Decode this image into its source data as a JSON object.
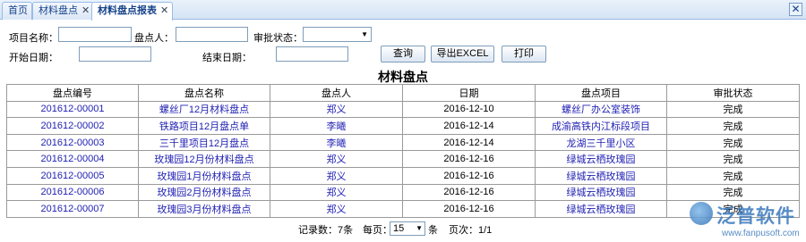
{
  "tabs": [
    {
      "label": "首页",
      "closable": false
    },
    {
      "label": "材料盘点",
      "closable": true
    },
    {
      "label": "材料盘点报表",
      "closable": true,
      "active": true
    }
  ],
  "window_close_label": "✕",
  "filters": {
    "project_name_label": "项目名称：",
    "project_name_value": "",
    "inventory_person_label": "盘点人：",
    "inventory_person_value": "",
    "approval_status_label": "审批状态：",
    "approval_status_value": "",
    "start_date_label": "开始日期：",
    "start_date_value": "",
    "end_date_label": "结束日期：",
    "end_date_value": ""
  },
  "buttons": {
    "query": "查询",
    "export": "导出EXCEL",
    "print": "打印"
  },
  "report_title": "材料盘点",
  "table": {
    "columns": [
      "盘点编号",
      "盘点名称",
      "盘点人",
      "日期",
      "盘点项目",
      "审批状态"
    ],
    "rows": [
      [
        "201612-00001",
        "螺丝厂12月材料盘点",
        "郑义",
        "2016-12-10",
        "螺丝厂办公室装饰",
        "完成"
      ],
      [
        "201612-00002",
        "铁路项目12月盘点单",
        "李曦",
        "2016-12-14",
        "成渝高铁内江标段项目",
        "完成"
      ],
      [
        "201612-00003",
        "三千里项目12月盘点",
        "李曦",
        "2016-12-14",
        "龙湖三千里小区",
        "完成"
      ],
      [
        "201612-00004",
        "玫瑰园12月份材料盘点",
        "郑义",
        "2016-12-16",
        "绿城云栖玫瑰园",
        "完成"
      ],
      [
        "201612-00005",
        "玫瑰园1月份材料盘点",
        "郑义",
        "2016-12-16",
        "绿城云栖玫瑰园",
        "完成"
      ],
      [
        "201612-00006",
        "玫瑰园2月份材料盘点",
        "郑义",
        "2016-12-16",
        "绿城云栖玫瑰园",
        "完成"
      ],
      [
        "201612-00007",
        "玫瑰园3月份材料盘点",
        "郑义",
        "2016-12-16",
        "绿城云栖玫瑰园",
        "完成"
      ]
    ]
  },
  "pager": {
    "record_count": "记录数：7条",
    "per_page_label": "每页：",
    "per_page_value": "15",
    "per_page_unit": "条",
    "page_info": "页次：1/1"
  },
  "logo": {
    "name": "泛普软件",
    "url": "www.fanpusoft.com"
  },
  "colors": {
    "link": "#1f1fb3",
    "tab_border": "#99bbe8",
    "tab_text": "#15428b"
  }
}
